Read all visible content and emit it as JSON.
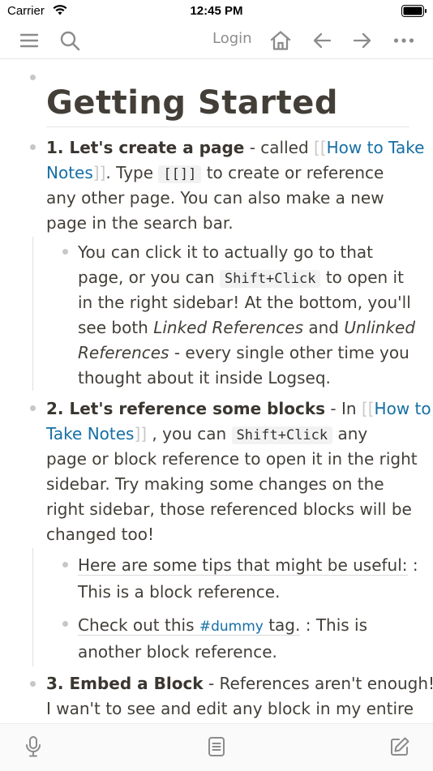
{
  "status_bar": {
    "carrier": "Carrier",
    "time": "12:45 PM"
  },
  "header": {
    "login_label": "Login",
    "icons": [
      "menu-icon",
      "search-icon",
      "home-icon",
      "back-arrow-icon",
      "forward-arrow-icon",
      "more-icon"
    ]
  },
  "page": {
    "title": "Getting Started",
    "block1": {
      "bold": "1. Let's create a page",
      "part1": " - called ",
      "link": "How to Take",
      "link2": "Notes",
      "part2": ". Type ",
      "code": "[[]]",
      "part3": " to create or reference",
      "line3": "any other page. You can also make a new",
      "line4": "page in the search bar."
    },
    "block1_child": {
      "line1": "You can click it to actually go to that",
      "line2a": "page, or you can ",
      "code": "Shift+Click",
      "line2b": " to open it",
      "line3": "in the right sidebar! At the bottom, you'll",
      "line4a": "see both ",
      "italic1": "Linked References",
      "line4b": " and ",
      "italic2a": "Unlinked",
      "italic2b": "References",
      "line5b": " - every single other time you",
      "line6": "thought about it inside Logseq."
    },
    "block2": {
      "bold": "2. Let's reference some blocks",
      "part1": " - In ",
      "link": "How to",
      "link2": "Take Notes",
      "part2": " , you can ",
      "code": "Shift+Click",
      "part3": " any",
      "line3": "page or block reference to open it in the right",
      "line4": "sidebar. Try making some changes on the",
      "line5": "right sidebar, those referenced blocks will be",
      "line6": "changed too!"
    },
    "block2_child1": {
      "ref": "Here are some tips that might be useful:",
      "after": " :",
      "line2": "This is a block reference."
    },
    "block2_child2": {
      "ref_a": "Check out this ",
      "tag": "#dummy",
      "ref_b": " tag.",
      "after": " : This is",
      "line2": "another block reference."
    },
    "block3": {
      "bold": "3. Embed a Block",
      "part1": " - References aren't enough!",
      "line2": "I wan't to see and edit any block in my entire"
    }
  },
  "footer": {
    "icons": [
      "microphone-icon",
      "document-icon",
      "edit-icon"
    ]
  },
  "colors": {
    "text": "#433f38",
    "link": "#156fa5",
    "icon": "#8c8c8c",
    "bullet": "#c7c7c7"
  }
}
